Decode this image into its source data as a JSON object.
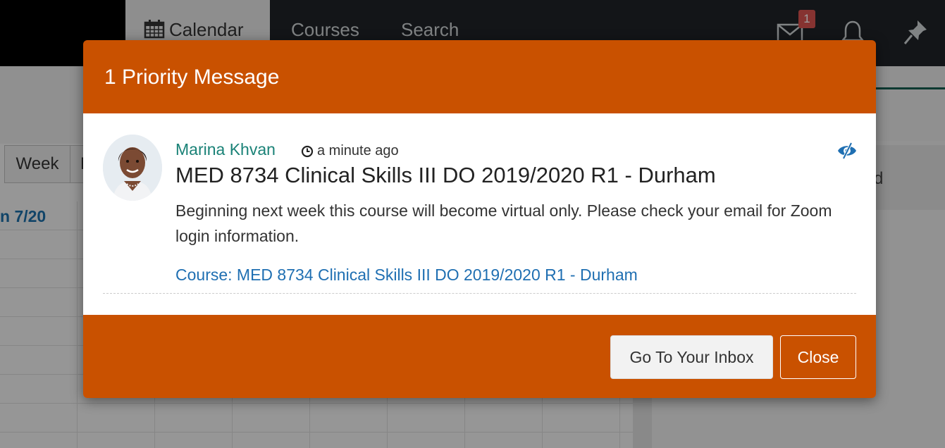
{
  "nav": {
    "calendar": "Calendar",
    "courses": "Courses",
    "search": "Search",
    "unread_badge": "1"
  },
  "background": {
    "week_button": "Week",
    "next_button": "N",
    "date_header": "n 7/20",
    "right_card_text": "d"
  },
  "modal": {
    "title": "1 Priority Message",
    "message": {
      "author": "Marina Khvan",
      "time": "a minute ago",
      "title": "MED 8734 Clinical Skills III DO 2019/2020 R1 - Durham",
      "body": "Beginning next week this course will become virtual only. Please check your email for Zoom login information.",
      "course_link": "Course: MED 8734 Clinical Skills III DO 2019/2020 R1 - Durham"
    },
    "buttons": {
      "inbox": "Go To Your Inbox",
      "close": "Close"
    }
  },
  "colors": {
    "accent_orange": "#c95100",
    "author_teal": "#1a8277",
    "link_blue": "#1f6fb2",
    "topbar": "#1f2327",
    "badge_red": "#d9534f"
  },
  "icons": [
    "calendar-icon",
    "mail-icon",
    "bell-icon",
    "pin-icon",
    "clock-icon",
    "eye-slash-icon",
    "avatar"
  ]
}
